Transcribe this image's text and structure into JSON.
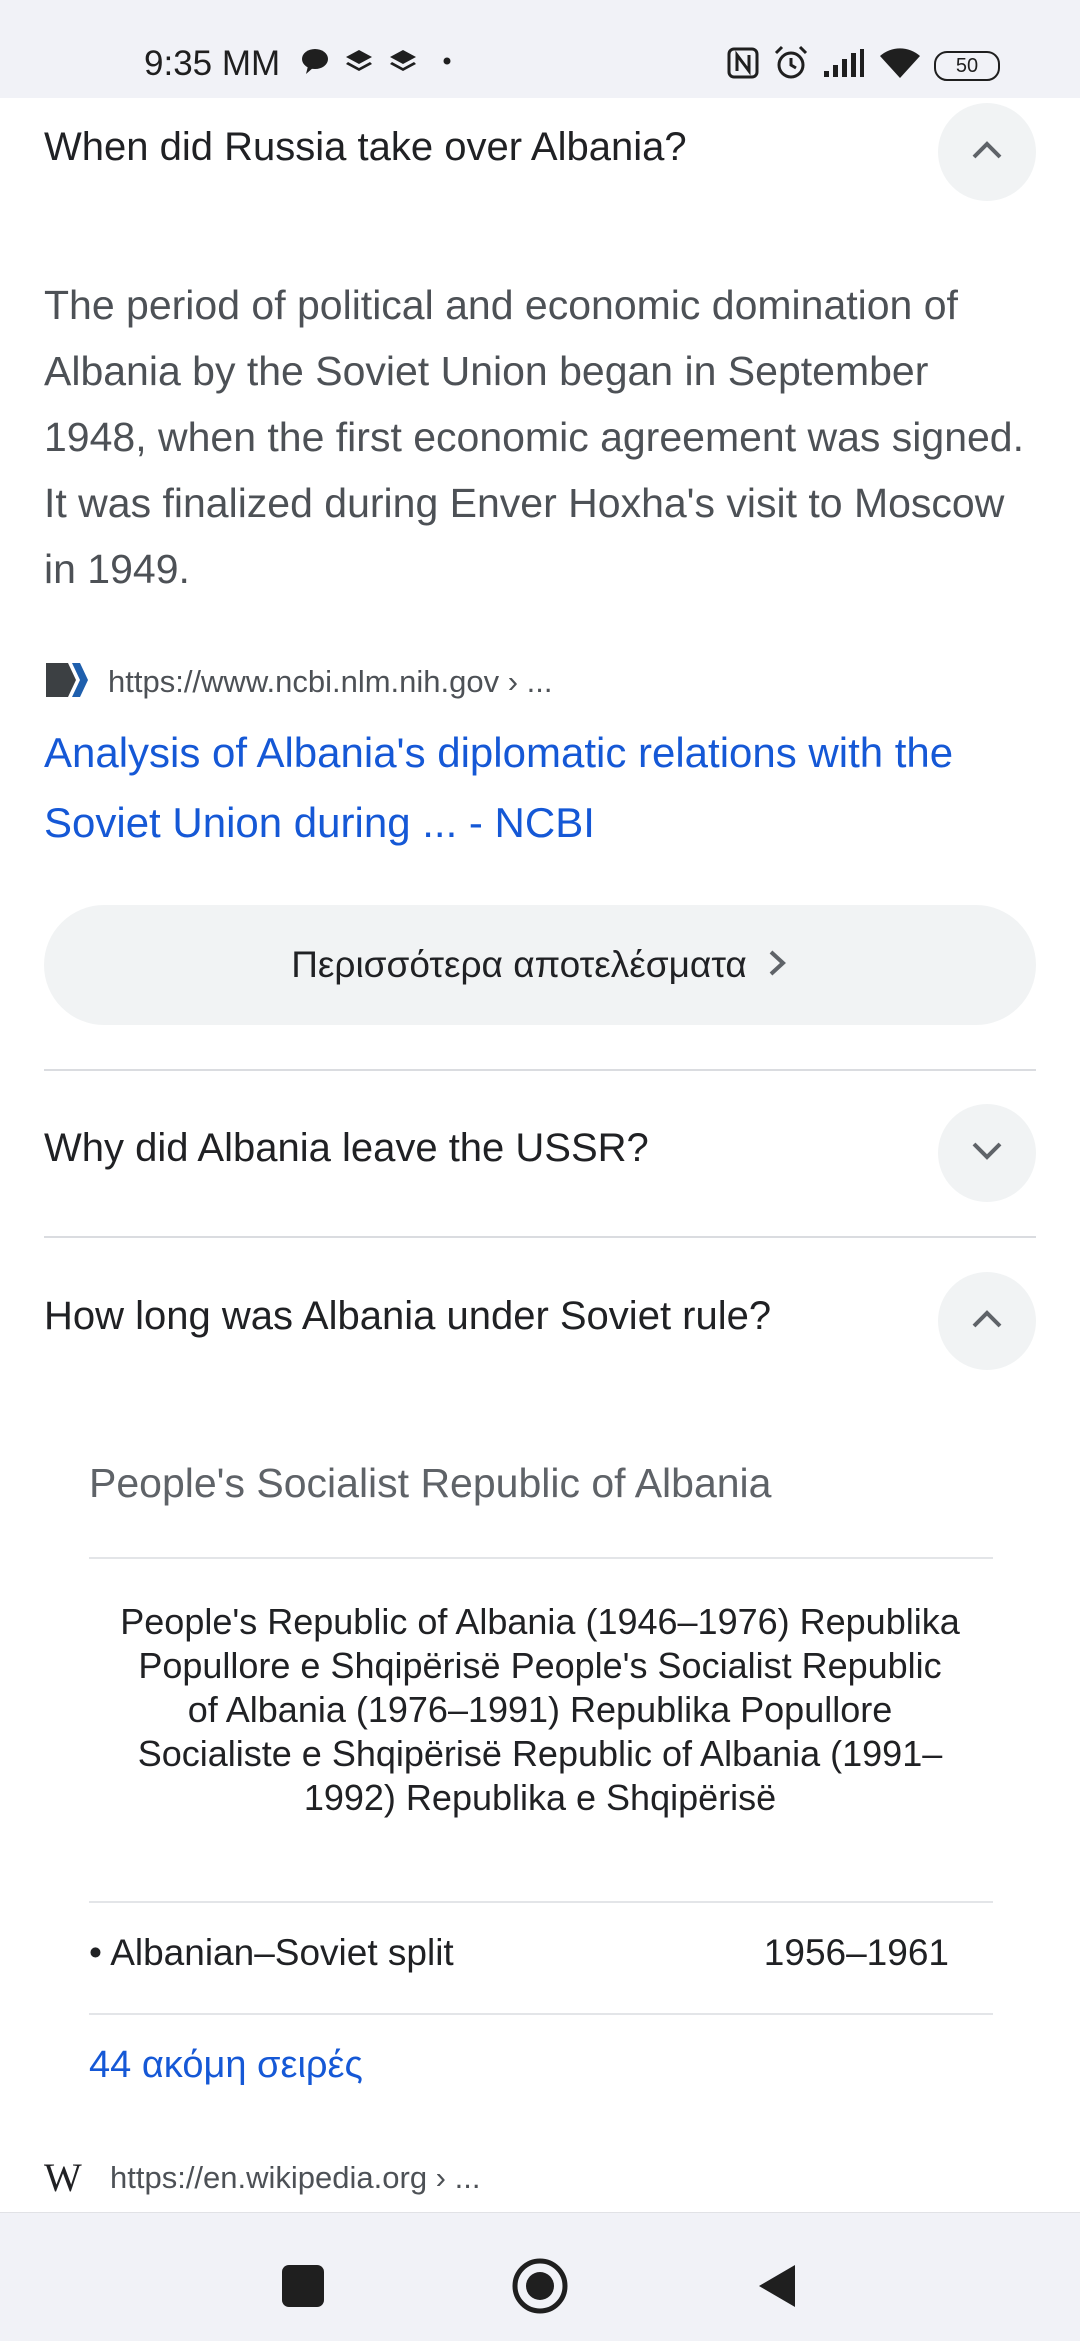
{
  "status_bar": {
    "time": "9:35 MM",
    "notification_icons": [
      "chat-bubble-icon",
      "layers-icon",
      "layers-icon",
      "dot-icon"
    ],
    "right_icons": [
      "nfc-icon",
      "alarm-icon",
      "signal-icon",
      "wifi-icon"
    ],
    "battery": "50"
  },
  "faq": [
    {
      "question": "When did Russia take over Albania?",
      "expanded": true,
      "answer": "The period of political and economic domination of Albania by the Soviet Union began in September 1948, when the first economic agreement was signed. It was finalized during Enver Hoxha's visit to Moscow in 1949.",
      "source_url": "https://www.ncbi.nlm.nih.gov › ...",
      "result_title": "Analysis of Albania's diplomatic relations with the Soviet Union during ... - NCBI"
    },
    {
      "question": "Why did Albania leave the USSR?",
      "expanded": false
    },
    {
      "question": "How long was Albania under Soviet rule?",
      "expanded": true,
      "panel_title": "People's Socialist Republic of Albania",
      "panel_description": "People's Republic of Albania (1946–1976) Republika Popullore e Shqipërisë People's Socialist Republic of Albania (1976–1991) Republika Popullore Socialiste e Shqipërisë Republic of Albania (1991–1992) Republika e Shqipërisë",
      "table_row": {
        "label": "• Albanian–Soviet split",
        "value": "1956–1961"
      },
      "more_rows_label": "44 ακόμη σειρές",
      "source_url": "https://en.wikipedia.org › ..."
    }
  ],
  "more_results_label": "Περισσότερα αποτελέσματα",
  "wiki_logo": "W",
  "colors": {
    "link": "#1558d6",
    "chip_bg": "#f1f3f4",
    "bar_bg": "#f1f2f7"
  }
}
